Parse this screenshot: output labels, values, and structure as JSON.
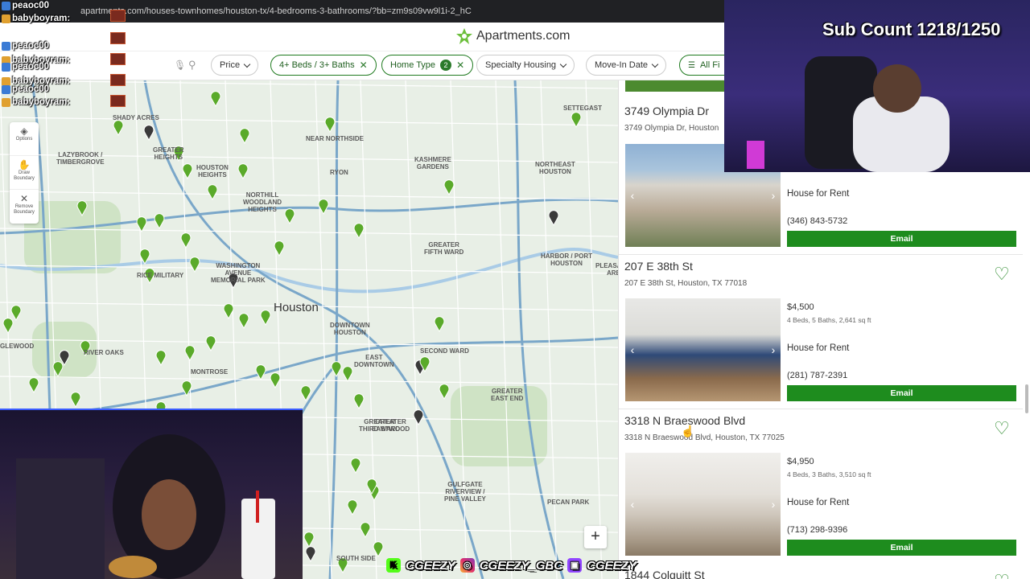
{
  "browser": {
    "url": "apartments.com/houses-townhomes/houston-tx/4-bedrooms-3-bathrooms/?bb=zm9s09vw9l1i-2_hC"
  },
  "header": {
    "logo_text": "Apartments.com"
  },
  "filters": [
    {
      "label": "Price",
      "active": false,
      "dropdown": true
    },
    {
      "label": "4+ Beds / 3+ Baths",
      "active": true,
      "closable": true
    },
    {
      "label": "Home Type",
      "active": true,
      "badge": "2",
      "closable": true
    },
    {
      "label": "Specialty Housing",
      "active": false,
      "dropdown": true
    },
    {
      "label": "Move-In Date",
      "active": false,
      "dropdown": true
    },
    {
      "label": "All Fi",
      "active": true,
      "icon": "sliders-icon"
    }
  ],
  "map": {
    "city_label": "Houston",
    "tools": [
      {
        "label": "Options",
        "icon": "layers-icon"
      },
      {
        "label": "Draw\nBoundary",
        "icon": "hand-icon"
      },
      {
        "label": "Remove\nBoundary",
        "icon": "close-icon"
      }
    ],
    "labels": [
      "SETTEGAST",
      "SHADY ACRES",
      "LAZYBROOK /\nTIMBERGROVE",
      "GREATER\nHEIGHTS",
      "HOUSTON\nHEIGHTS",
      "NORTHILL\nWOODLAND\nHEIGHTS",
      "NEAR NORTHSIDE",
      "RYON",
      "KASHMERE\nGARDENS",
      "NORTHEAST\nHOUSTON",
      "GREATER\nFIFTH WARD",
      "HARBOR / PORT\nHOUSTON",
      "PLEASANTVI\nAREA",
      "WASHINGTON\nAVENUE\nMEMORIAL PARK",
      "RICE MILITARY",
      "DOWNTOWN\nHOUSTON",
      "EAST\nDOWNTOWN",
      "SECOND WARD",
      "GREATER\nEASTWOOD",
      "GREATER\nEAST END",
      "RIVER OAKS",
      "MONTROSE",
      "GREATER\nTHIRD WARD",
      "GULFGATE\nRIVERVIEW /\nPINE VALLEY",
      "PECAN PARK",
      "SOUTH SIDE",
      "GLEWOOD"
    ],
    "zoom_in_label": "+"
  },
  "listings": [
    {
      "name": "3749 Olympia Dr",
      "address": "3749 Olympia Dr, Houston",
      "price": "",
      "specs": "",
      "type": "House for Rent",
      "phone": "(346) 843-5732",
      "email_label": "Email"
    },
    {
      "name": "207 E 38th St",
      "address": "207 E 38th St, Houston, TX 77018",
      "price": "$4,500",
      "specs": "4 Beds, 5 Baths, 2,641 sq ft",
      "type": "House for Rent",
      "phone": "(281) 787-2391",
      "email_label": "Email"
    },
    {
      "name": "3318 N Braeswood Blvd",
      "address": "3318 N Braeswood Blvd, Houston, TX 77025",
      "price": "$4,950",
      "specs": "4 Beds, 3 Baths, 3,510 sq ft",
      "type": "House for Rent",
      "phone": "(713) 298-9396",
      "email_label": "Email"
    },
    {
      "name": "1844 Colquitt St"
    }
  ],
  "stream": {
    "sub_count": "Sub Count 1218/1250",
    "chat": [
      "peaoc00",
      "babyboyram:",
      "peaoc00",
      "babyboyram:",
      "peaoc00",
      "babyboyram:",
      "peaoc00",
      "babyboyram:"
    ],
    "socials": [
      "CGEEZY",
      "CGEEZY_GBC",
      "CGEEZY"
    ]
  },
  "colors": {
    "brand_green": "#1e8c1e",
    "heart_green": "#2b8a2b",
    "map_bg": "#e8efe6",
    "accent_blue": "#3a5cff"
  }
}
